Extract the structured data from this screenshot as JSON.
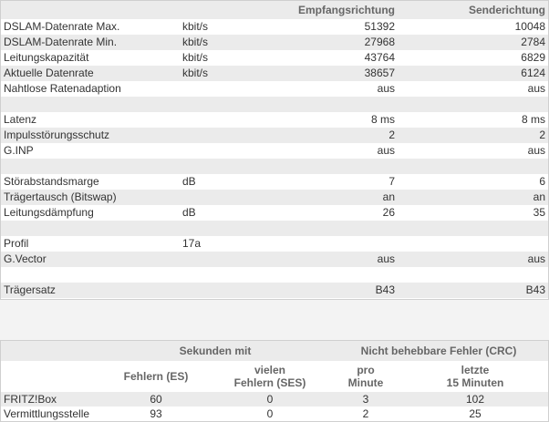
{
  "dsl": {
    "headers": {
      "receive": "Empfangsrichtung",
      "send": "Senderichtung"
    },
    "rows": [
      {
        "label": "DSLAM-Datenrate Max.",
        "unit": "kbit/s",
        "rx": "51392",
        "tx": "10048",
        "alt": false
      },
      {
        "label": "DSLAM-Datenrate Min.",
        "unit": "kbit/s",
        "rx": "27968",
        "tx": "2784",
        "alt": true
      },
      {
        "label": "Leitungskapazität",
        "unit": "kbit/s",
        "rx": "43764",
        "tx": "6829",
        "alt": false
      },
      {
        "label": "Aktuelle Datenrate",
        "unit": "kbit/s",
        "rx": "38657",
        "tx": "6124",
        "alt": true
      },
      {
        "label": "Nahtlose Ratenadaption",
        "unit": "",
        "rx": "aus",
        "tx": "aus",
        "alt": false
      },
      {
        "label": "",
        "unit": "",
        "rx": "",
        "tx": "",
        "alt": true
      },
      {
        "label": "Latenz",
        "unit": "",
        "rx": "8 ms",
        "tx": "8 ms",
        "alt": false
      },
      {
        "label": "Impulsstörungsschutz",
        "unit": "",
        "rx": "2",
        "tx": "2",
        "alt": true
      },
      {
        "label": "G.INP",
        "unit": "",
        "rx": "aus",
        "tx": "aus",
        "alt": false
      },
      {
        "label": "",
        "unit": "",
        "rx": "",
        "tx": "",
        "alt": true
      },
      {
        "label": "Störabstandsmarge",
        "unit": "dB",
        "rx": "7",
        "tx": "6",
        "alt": false
      },
      {
        "label": "Trägertausch (Bitswap)",
        "unit": "",
        "rx": "an",
        "tx": "an",
        "alt": true
      },
      {
        "label": "Leitungsdämpfung",
        "unit": "dB",
        "rx": "26",
        "tx": "35",
        "alt": false
      },
      {
        "label": "",
        "unit": "",
        "rx": "",
        "tx": "",
        "alt": true
      },
      {
        "label": "Profil",
        "unit": "17a",
        "rx": "",
        "tx": "",
        "alt": false
      },
      {
        "label": "G.Vector",
        "unit": "",
        "rx": "aus",
        "tx": "aus",
        "alt": true
      },
      {
        "label": "",
        "unit": "",
        "rx": "",
        "tx": "",
        "alt": false
      },
      {
        "label": "Trägersatz",
        "unit": "",
        "rx": "B43",
        "tx": "B43",
        "alt": true
      }
    ]
  },
  "errors": {
    "group_seconds": "Sekunden mit",
    "group_crc": "Nicht behebbare Fehler (CRC)",
    "col_es": "Fehlern (ES)",
    "col_ses_1": "vielen",
    "col_ses_2": "Fehlern (SES)",
    "col_min_1": "pro",
    "col_min_2": "Minute",
    "col_15_1": "letzte",
    "col_15_2": "15 Minuten",
    "rows": [
      {
        "label": "FRITZ!Box",
        "es": "60",
        "ses": "0",
        "per_min": "3",
        "last15": "102"
      },
      {
        "label": "Vermittlungsstelle",
        "es": "93",
        "ses": "0",
        "per_min": "2",
        "last15": "25"
      }
    ]
  }
}
